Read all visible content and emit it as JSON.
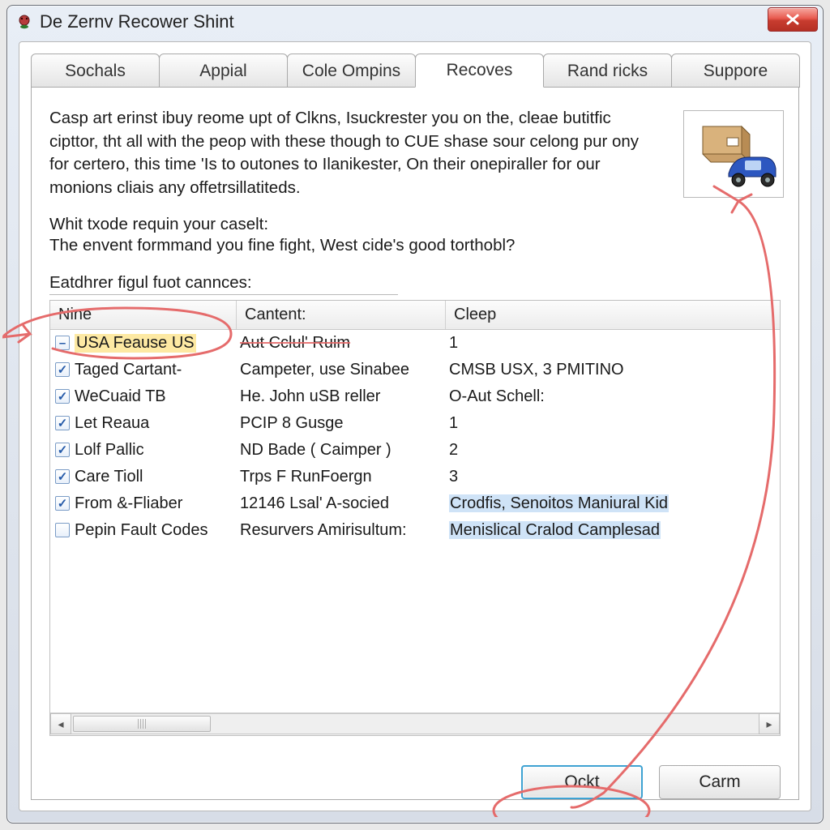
{
  "window": {
    "title": "De Zernv Recower Shint"
  },
  "tabs": {
    "items": [
      {
        "label": "Sochals"
      },
      {
        "label": "Appial"
      },
      {
        "label": "Cole Ompins"
      },
      {
        "label": "Recoves"
      },
      {
        "label": "Rand ricks"
      },
      {
        "label": "Suppore"
      }
    ],
    "active_index": 3
  },
  "description": {
    "paragraph": "Casp art erinst ibuy reome upt of Clkns, Isuckrester you on the, cleae butitfic cipttor, tht all with the peop with these though to CUE shase sour celong pur ony for certero, this time 'Is to outones to Ilanikester, On their onepiraller for our monions cliais any offetrsillatiteds.",
    "prompt1": "Whit txode requin your caselt:",
    "prompt2": "The envent formmand you fine fight, West cide's good torthobl?",
    "list_label": "Eatdhrer figul fuot cannces:"
  },
  "table": {
    "headers": {
      "c1": "Nine",
      "c2": "Cantent:",
      "c3": "Cleep"
    },
    "rows": [
      {
        "check": "minus",
        "c1": "USA Feause US",
        "c2": "Aut Cclul' Ruim",
        "c3": "1",
        "first_highlight": true,
        "strike_c2": true
      },
      {
        "check": "checked",
        "c1": "Taged Cartant-",
        "c2": "Campeter, use Sinabee",
        "c3": "CMSB USX, 3 PMITINO"
      },
      {
        "check": "checked",
        "c1": "WeCuaid TB",
        "c2": "He. John uSB reller",
        "c3": "O-Aut Schell:"
      },
      {
        "check": "checked",
        "c1": "Let Reaua",
        "c2": "PCIP 8 Gusge",
        "c3": "1"
      },
      {
        "check": "checked",
        "c1": "Lolf Pallic",
        "c2": "ND Bade ( Caimper )",
        "c3": "2"
      },
      {
        "check": "checked",
        "c1": "Care Tioll",
        "c2": "Trps F RunFoergn",
        "c3": "3"
      },
      {
        "check": "checked",
        "c1": "From &-Fliaber",
        "c2": "12146 Lsal' A-socied",
        "c3": "Crodfis, Senoitos Maniural Kid",
        "c3_highlight": true
      },
      {
        "check": "none",
        "c1": "Pepin Fault Codes",
        "c2": "Resurvers Amirisultum:",
        "c3": "Menislical Cralod Camplesad",
        "c3_highlight": true
      }
    ]
  },
  "buttons": {
    "ok": "Ockt",
    "cancel": "Carm"
  },
  "colors": {
    "annotation": "#e56b6b",
    "primary_border": "#3ea2d2",
    "checkbox": "#2459a8"
  }
}
